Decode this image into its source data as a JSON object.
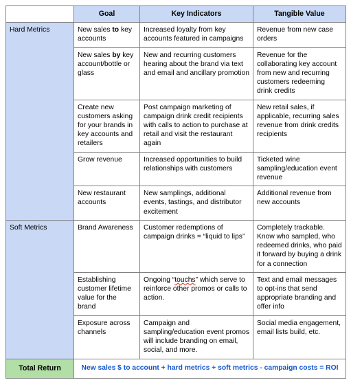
{
  "table": {
    "columns": [
      {
        "key": "metric_group",
        "label": ""
      },
      {
        "key": "goal",
        "label": "Goal"
      },
      {
        "key": "key_indicators",
        "label": "Key Indicators"
      },
      {
        "key": "tangible_value",
        "label": "Tangible Value"
      }
    ],
    "groups": [
      {
        "label": "Hard Metrics",
        "rows": [
          {
            "goal_pre": "New sales ",
            "goal_bold": "to",
            "goal_post": " key accounts",
            "key_indicators": "Increased loyalty from key accounts featured in campaigns",
            "tangible_value": "Revenue from new case orders"
          },
          {
            "goal_pre": "New sales ",
            "goal_bold": "by",
            "goal_post": " key account/bottle or glass",
            "key_indicators": "New and recurring customers hearing about the brand via text and email and ancillary promotion",
            "tangible_value": "Revenue for the collaborating key account from new and recurring customers redeeming drink credits"
          },
          {
            "goal_pre": "Create new customers asking for your brands in key accounts and retailers",
            "goal_bold": "",
            "goal_post": "",
            "key_indicators": "Post campaign marketing of campaign drink credit recipients with calls to action to purchase at retail and visit the restaurant again",
            "tangible_value": "New retail sales, if applicable, recurring sales revenue from drink credits recipients"
          },
          {
            "goal_pre": "Grow revenue",
            "goal_bold": "",
            "goal_post": "",
            "key_indicators": "Increased opportunities to build relationships with customers",
            "tangible_value": "Ticketed wine sampling/education event revenue"
          },
          {
            "goal_pre": "New restaurant accounts",
            "goal_bold": "",
            "goal_post": "",
            "key_indicators": "New samplings, additional events, tastings, and distributor excitement",
            "tangible_value": "Additional revenue from new accounts"
          }
        ]
      },
      {
        "label": "Soft Metrics",
        "rows": [
          {
            "goal_pre": "Brand Awareness",
            "goal_bold": "",
            "goal_post": "",
            "key_indicators": "Customer redemptions of campaign drinks = “liquid to lips”",
            "tangible_value": "Completely trackable. Know who sampled, who redeemed drinks, who paid it forward by buying a drink for a connection"
          },
          {
            "goal_pre": "Establishing customer lifetime value for the brand",
            "goal_bold": "",
            "goal_post": "",
            "key_indicators_pre": "Ongoing “",
            "key_indicators_misspelled": "touchs",
            "key_indicators_post": "” which serve to reinforce other promos or calls to action.",
            "key_indicators": "Ongoing “touchs” which serve to reinforce other promos or calls to action.",
            "tangible_value": "Text and email messages to opt-ins that send appropriate branding and offer info"
          },
          {
            "goal_pre": "Exposure across channels",
            "goal_bold": "",
            "goal_post": "",
            "key_indicators": "Campaign and sampling/education event promos will include branding on email, social, and more.",
            "tangible_value": "Social media engagement, email lists build, etc."
          }
        ]
      }
    ],
    "total": {
      "label": "Total Return",
      "formula": "New sales $ to account + hard metrics + soft metrics - campaign costs  = ROI"
    }
  },
  "colors": {
    "header_blue": "#c9d8f5",
    "group_blue": "#c9d8f5",
    "total_green": "#b2dfa5",
    "formula_blue": "#1155cc",
    "border_gray": "#7f7f7f",
    "spellcheck_red": "#e03b2f"
  }
}
